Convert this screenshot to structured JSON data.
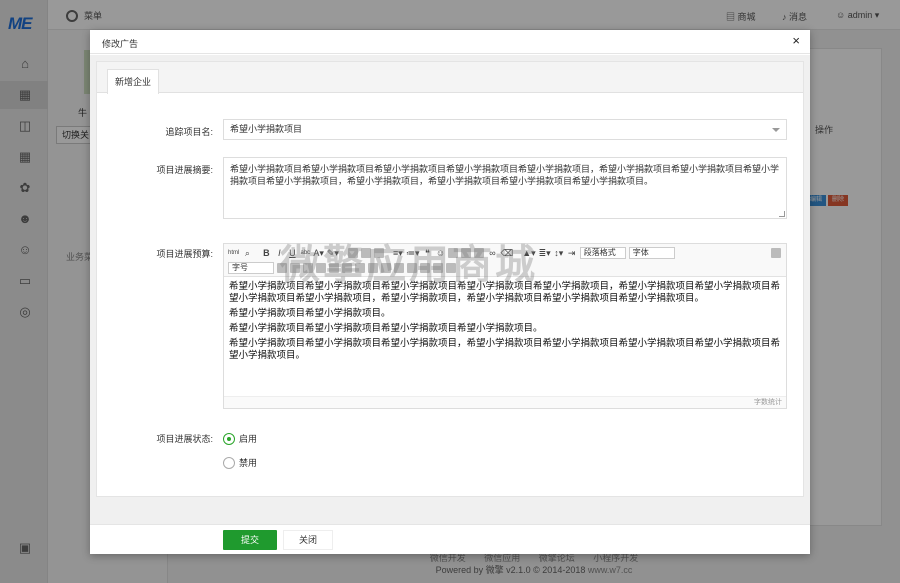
{
  "app": {
    "logo": "ME"
  },
  "topbar": {
    "menu_label": "菜单",
    "store_label": "商城",
    "msg_label": "消息",
    "user_label": "admin"
  },
  "background": {
    "user_name": "牛",
    "switch_label": "切换关",
    "section_label": "业务菜",
    "op_header": "操作",
    "op_edit": "编辑",
    "op_delete": "删除"
  },
  "footer": {
    "links": [
      "微信开发",
      "微信应用",
      "微擎论坛",
      "小程序开发"
    ],
    "powered": "Powered by 微擎 v2.1.0 © 2014-2018",
    "site": "www.w7.cc"
  },
  "modal": {
    "title": "修改广告",
    "close_symbol": "×",
    "tab_label": "新增企业",
    "fields": {
      "project_label": "追踪项目名:",
      "project_value": "希望小学捐款项目",
      "summary_label": "项目进展摘要:",
      "summary_value": "希望小学捐款项目希望小学捐款项目希望小学捐款项目希望小学捐款项目希望小学捐款项目，希望小学捐款项目希望小学捐款项目希望小学捐款项目希望小学捐款项目，希望小学捐款项目，希望小学捐款项目希望小学捐款项目希望小学捐款项目。",
      "budget_label": "项目进展预算:",
      "status_label": "项目进展状态:"
    },
    "editor": {
      "para_format": "段落格式",
      "font_family": "字体",
      "font_size": "字号",
      "paragraphs": [
        "希望小学捐款项目希望小学捐款项目希望小学捐款项目希望小学捐款项目希望小学捐款项目，希望小学捐款项目希望小学捐款项目希望小学捐款项目希望小学捐款项目，希望小学捐款项目，希望小学捐款项目希望小学捐款项目希望小学捐款项目。",
        "希望小学捐款项目希望小学捐款项目。",
        "希望小学捐款项目希望小学捐款项目希望小学捐款项目希望小学捐款项目。",
        "希望小学捐款项目希望小学捐款项目希望小学捐款项目，希望小学捐款项目希望小学捐款项目希望小学捐款项目希望小学捐款项目希望小学捐款项目。"
      ],
      "word_count_label": "字数统计"
    },
    "status_options": [
      {
        "label": "启用",
        "selected": true
      },
      {
        "label": "禁用",
        "selected": false
      }
    ],
    "buttons": {
      "submit": "提交",
      "close": "关闭"
    },
    "colors": {
      "submit": "#1f9a2e",
      "radio_on": "#2aa52a"
    }
  },
  "watermark": "微擎应用商城"
}
